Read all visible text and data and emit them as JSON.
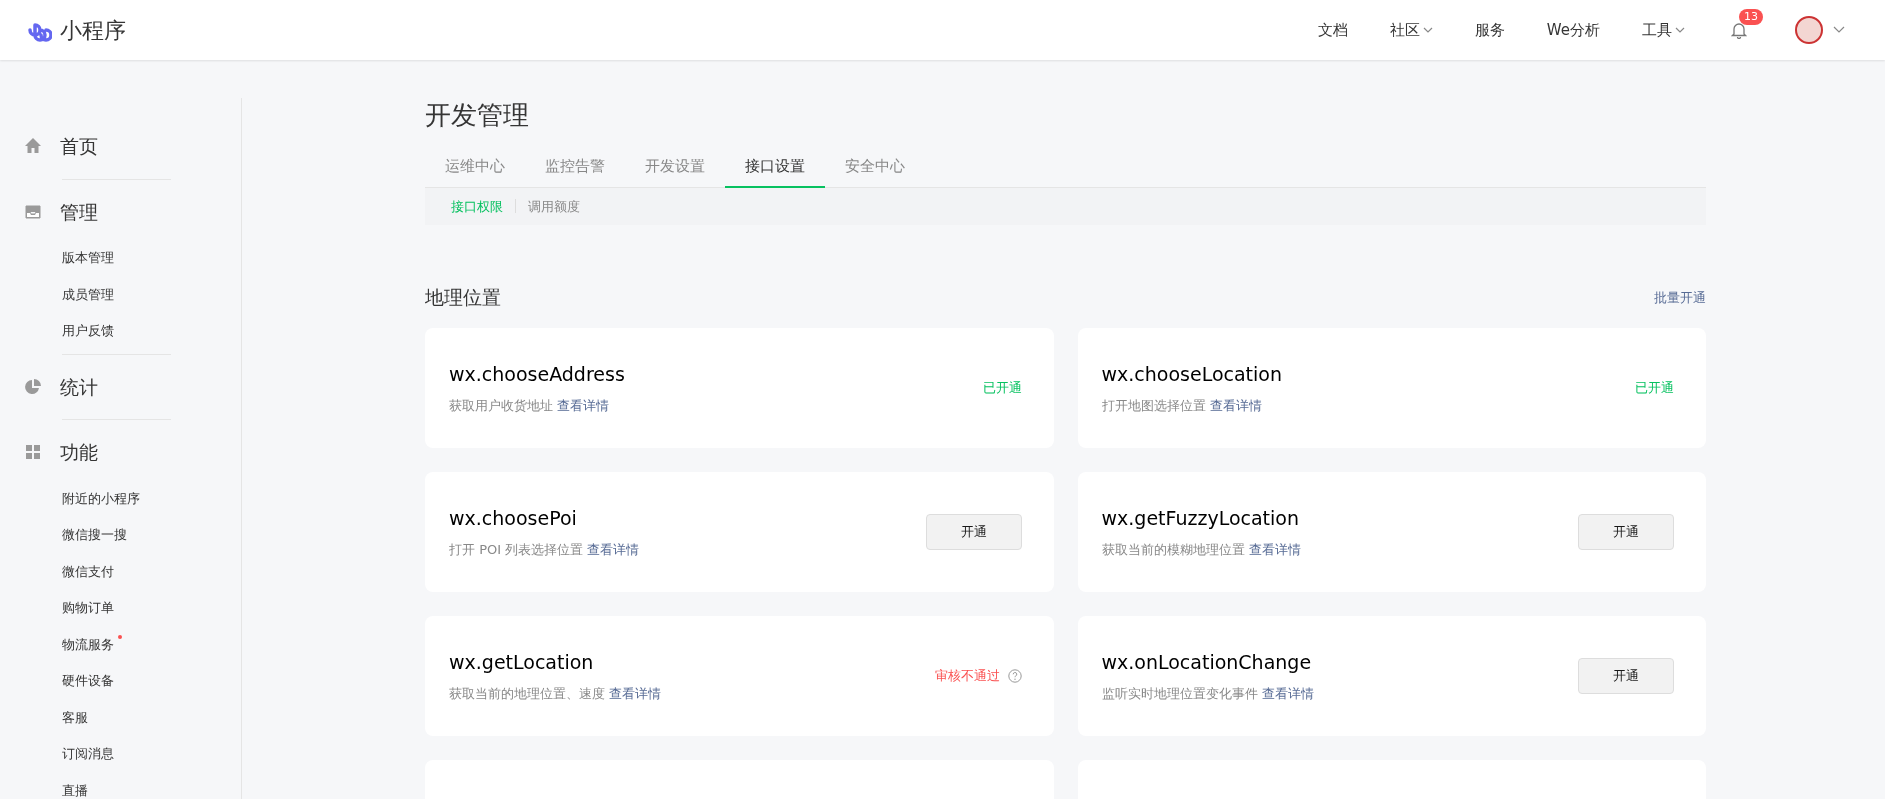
{
  "brand": {
    "name": "小程序"
  },
  "top_nav": [
    {
      "label": "文档",
      "dropdown": false
    },
    {
      "label": "社区",
      "dropdown": true
    },
    {
      "label": "服务",
      "dropdown": false
    },
    {
      "label": "We分析",
      "dropdown": false
    },
    {
      "label": "工具",
      "dropdown": true
    }
  ],
  "notifications": {
    "count": "13"
  },
  "sidebar": [
    {
      "title": "首页",
      "kind": "home"
    },
    {
      "title": "管理",
      "kind": "inbox",
      "items": [
        {
          "label": "版本管理",
          "dot": false
        },
        {
          "label": "成员管理",
          "dot": false
        },
        {
          "label": "用户反馈",
          "dot": false
        }
      ]
    },
    {
      "title": "统计",
      "kind": "pie"
    },
    {
      "title": "功能",
      "kind": "grid",
      "items": [
        {
          "label": "附近的小程序",
          "dot": false
        },
        {
          "label": "微信搜一搜",
          "dot": false
        },
        {
          "label": "微信支付",
          "dot": false
        },
        {
          "label": "购物订单",
          "dot": false
        },
        {
          "label": "物流服务",
          "dot": true
        },
        {
          "label": "硬件设备",
          "dot": false
        },
        {
          "label": "客服",
          "dot": false
        },
        {
          "label": "订阅消息",
          "dot": false
        },
        {
          "label": "直播",
          "dot": false
        }
      ]
    }
  ],
  "page_title": "开发管理",
  "tabs": [
    {
      "label": "运维中心",
      "selected": false
    },
    {
      "label": "监控告警",
      "selected": false
    },
    {
      "label": "开发设置",
      "selected": false
    },
    {
      "label": "接口设置",
      "selected": true
    },
    {
      "label": "安全中心",
      "selected": false
    }
  ],
  "sub_tabs": [
    {
      "label": "接口权限",
      "selected": true
    },
    {
      "label": "调用额度",
      "selected": false
    }
  ],
  "section": {
    "title": "地理位置",
    "action": "批量开通"
  },
  "apis": [
    {
      "name": "wx.chooseAddress",
      "desc": "获取用户收货地址",
      "link": "查看详情",
      "kind": "opened",
      "status": "已开通"
    },
    {
      "name": "wx.chooseLocation",
      "desc": "打开地图选择位置",
      "link": "查看详情",
      "kind": "opened",
      "status": "已开通"
    },
    {
      "name": "wx.choosePoi",
      "desc": "打开 POI 列表选择位置",
      "link": "查看详情",
      "kind": "button",
      "status": "开通"
    },
    {
      "name": "wx.getFuzzyLocation",
      "desc": "获取当前的模糊地理位置",
      "link": "查看详情",
      "kind": "button",
      "status": "开通"
    },
    {
      "name": "wx.getLocation",
      "desc": "获取当前的地理位置、速度",
      "link": "查看详情",
      "kind": "rejected",
      "status": "审核不通过"
    },
    {
      "name": "wx.onLocationChange",
      "desc": "监听实时地理位置变化事件",
      "link": "查看详情",
      "kind": "button",
      "status": "开通"
    }
  ]
}
